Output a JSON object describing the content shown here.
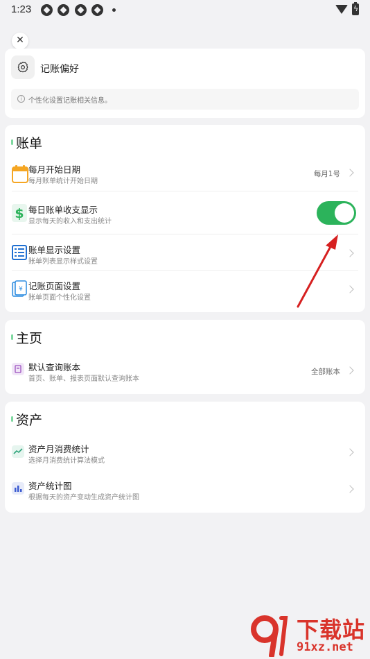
{
  "status_bar": {
    "time": "1:23"
  },
  "header": {
    "title": "记账偏好",
    "hint": "个性化设置记账相关信息。"
  },
  "sections": [
    {
      "title": "账单",
      "items": [
        {
          "title": "每月开始日期",
          "subtitle": "每月账单统计开始日期",
          "value": "每月1号",
          "icon": "calendar-icon"
        },
        {
          "title": "每日账单收支显示",
          "subtitle": "显示每天的收入和支出统计",
          "toggle_on": true,
          "icon": "dollar-icon"
        },
        {
          "title": "账单显示设置",
          "subtitle": "账单列表显示样式设置",
          "icon": "list-icon"
        },
        {
          "title": "记账页面设置",
          "subtitle": "账单页面个性化设置",
          "icon": "receipt-icon"
        }
      ]
    },
    {
      "title": "主页",
      "items": [
        {
          "title": "默认查询账本",
          "subtitle": "首页、账单、报表页面默认查询账本",
          "value": "全部账本",
          "icon": "ledger-icon"
        }
      ]
    },
    {
      "title": "资产",
      "items": [
        {
          "title": "资产月消费统计",
          "subtitle": "选择月消费统计算法模式",
          "icon": "trend-icon"
        },
        {
          "title": "资产统计图",
          "subtitle": "根据每天的资产变动生成资产统计图",
          "icon": "bar-chart-icon"
        }
      ]
    }
  ],
  "watermark": {
    "title": "下载站",
    "url": "91xz.net"
  },
  "colors": {
    "toggle_on": "#2cb35b",
    "accent_bar": "#7ed8a0",
    "annotation_arrow": "#d62020"
  }
}
